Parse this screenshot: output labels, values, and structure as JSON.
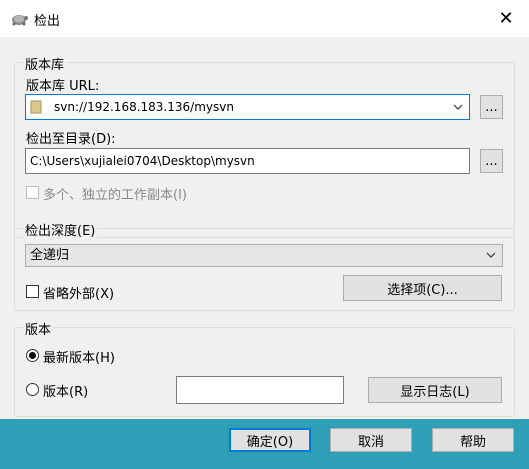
{
  "window": {
    "title": "检出",
    "close_glyph": "✕"
  },
  "repository": {
    "legend": "版本库",
    "url_label": "版本库 URL:",
    "url_value": "svn://192.168.183.136/mysvn",
    "browse_label": "...",
    "checkout_dir_label": "检出至目录(D):",
    "checkout_dir_value": "C:\\Users\\xujialei0704\\Desktop\\mysvn",
    "checkout_browse_label": "...",
    "multiple_copies_label": "多个、独立的工作副本(I)"
  },
  "depth": {
    "legend": "检出深度(E)",
    "selected": "全递归",
    "omit_externals_label": "省略外部(X)",
    "options_button": "选择项(C)..."
  },
  "revision": {
    "legend": "版本",
    "head_label": "最新版本(H)",
    "revision_label": "版本(R)",
    "revision_value": "",
    "show_log_button": "显示日志(L)"
  },
  "buttons": {
    "ok": "确定(O)",
    "cancel": "取消",
    "help": "帮助"
  },
  "colors": {
    "footer": "#2f9fb8",
    "accent": "#0078d7"
  }
}
